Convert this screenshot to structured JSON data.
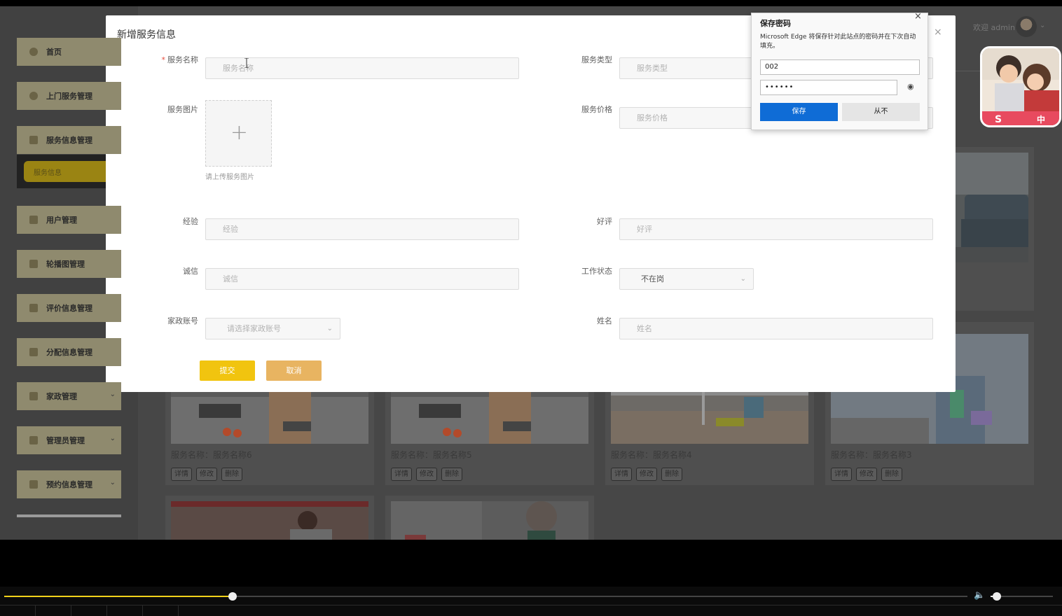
{
  "sidebar": {
    "items": [
      {
        "label": "首页",
        "icon": "home-icon",
        "has_arrow": false
      },
      {
        "label": "上门服务管理",
        "icon": "service-icon",
        "has_arrow": false
      },
      {
        "label": "服务信息管理",
        "icon": "grid-icon",
        "has_arrow": false
      },
      {
        "label": "用户管理",
        "icon": "user-icon",
        "has_arrow": false
      },
      {
        "label": "轮播图管理",
        "icon": "carousel-icon",
        "has_arrow": false
      },
      {
        "label": "评价信息管理",
        "icon": "grid-icon",
        "has_arrow": false
      },
      {
        "label": "分配信息管理",
        "icon": "folder-icon",
        "has_arrow": false
      },
      {
        "label": "家政管理",
        "icon": "user-icon",
        "has_arrow": true
      },
      {
        "label": "管理员管理",
        "icon": "lock-icon",
        "has_arrow": true
      },
      {
        "label": "预约信息管理",
        "icon": "calendar-icon",
        "has_arrow": true
      }
    ],
    "active_subitem": "服务信息"
  },
  "header": {
    "welcome": "欢迎 admin",
    "avatar_icon": "user-avatar-icon",
    "menu_arrow": "⌄"
  },
  "cards": [
    {
      "caption": "服务名称：服务名称6",
      "buttons": [
        "详情",
        "修改",
        "删除"
      ]
    },
    {
      "caption": "服务名称：服务名称5",
      "buttons": [
        "详情",
        "修改",
        "删除"
      ]
    },
    {
      "caption": "服务名称：服务名称4",
      "buttons": [
        "详情",
        "修改",
        "删除"
      ]
    },
    {
      "caption": "服务名称：服务名称3",
      "buttons": [
        "详情",
        "修改",
        "删除"
      ]
    }
  ],
  "modal": {
    "title": "新增服务信息",
    "close": "×",
    "fields": {
      "service_name": {
        "label": "服务名称",
        "placeholder": "服务名称",
        "required": true
      },
      "service_type": {
        "label": "服务类型",
        "placeholder": "服务类型"
      },
      "service_image": {
        "label": "服务图片",
        "hint": "请上传服务图片",
        "plus": "+"
      },
      "service_price": {
        "label": "服务价格",
        "placeholder": "服务价格"
      },
      "experience": {
        "label": "经验",
        "placeholder": "经验"
      },
      "rating": {
        "label": "好评",
        "placeholder": "好评"
      },
      "integrity": {
        "label": "诚信",
        "placeholder": "诚信"
      },
      "work_status": {
        "label": "工作状态",
        "value": "不在岗"
      },
      "housekeeping_account": {
        "label": "家政账号",
        "placeholder": "请选择家政账号"
      },
      "name": {
        "label": "姓名",
        "placeholder": "姓名"
      }
    },
    "submit_label": "提交",
    "cancel_label": "取消"
  },
  "password_popup": {
    "title": "保存密码",
    "close": "×",
    "description": "Microsoft Edge 将保存针对此站点的密码并在下次自动填充。",
    "username": "002",
    "password_mask": "••••••",
    "eye_icon": "◉",
    "save_label": "保存",
    "never_label": "从不",
    "accent_color": "#0f6cd6"
  },
  "player": {
    "progress": 0.237,
    "volume": 0.1,
    "volume_icon": "🔈",
    "accent_color": "#f1d21a"
  },
  "colors": {
    "primary_yellow": "#f1c40f",
    "cancel_orange": "#e8b461"
  }
}
